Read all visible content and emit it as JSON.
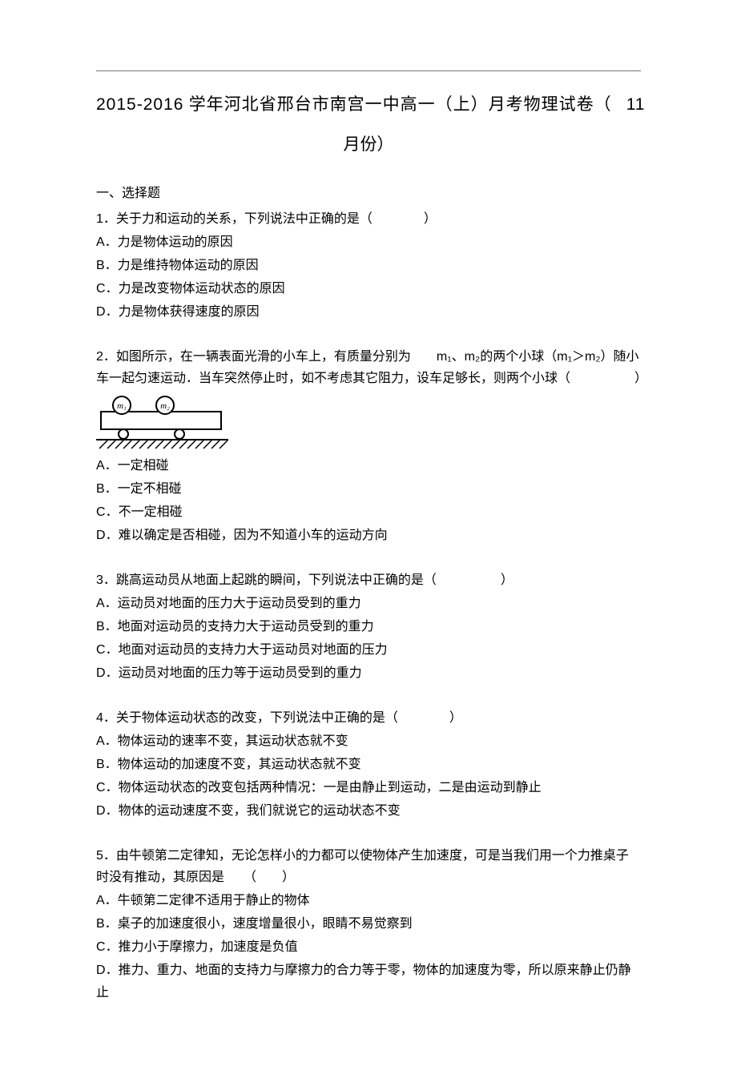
{
  "title": {
    "prefix_years": "2015-2016",
    "main_cn": " 学年河北省邢台市南宫一中高一（上）月考物理试卷（",
    "month_num": "11",
    "line2": "月份）"
  },
  "section_heading": "一、选择题",
  "q1": {
    "stem_num": "1",
    "stem_text": "．关于力和运动的关系，下列说法中正确的是（　　　　）",
    "optA_label": "A",
    "optA_text": "．力是物体运动的原因",
    "optB_label": "B",
    "optB_text": "．力是维持物体运动的原因",
    "optC_label": "C",
    "optC_text": "．力是改变物体运动状态的原因",
    "optD_label": "D",
    "optD_text": "．力是物体获得速度的原因"
  },
  "q2": {
    "stem_num": "2",
    "stem_part1": "．如图所示，在一辆表面光滑的小车上，有质量分别为　　",
    "m1": "m₁",
    "sep1": "、",
    "m2": "m₂",
    "stem_part2": "的两个小球（",
    "m1b": "m₁",
    "gt": "＞",
    "m2b": "m₂",
    "stem_part3": "）随小车一起匀速运动．当车突然停止时，如不考虑其它阻力，设车足够长，则两个小球（　　　　　）",
    "fig_m1": "m₁",
    "fig_m2": "m₂",
    "optA_label": "A",
    "optA_text": "．一定相碰",
    "optB_label": "B",
    "optB_text": "．一定不相碰",
    "optC_label": "C",
    "optC_text": "．不一定相碰",
    "optD_label": "D",
    "optD_text": "．难以确定是否相碰，因为不知道小车的运动方向"
  },
  "q3": {
    "stem_num": "3",
    "stem_text": "．跳高运动员从地面上起跳的瞬间，下列说法中正确的是（　　　　　）",
    "optA_label": "A",
    "optA_text": "．运动员对地面的压力大于运动员受到的重力",
    "optB_label": "B",
    "optB_text": "．地面对运动员的支持力大于运动员受到的重力",
    "optC_label": "C",
    "optC_text": "．地面对运动员的支持力大于运动员对地面的压力",
    "optD_label": "D",
    "optD_text": "．运动员对地面的压力等于运动员受到的重力"
  },
  "q4": {
    "stem_num": "4",
    "stem_text": "．关于物体运动状态的改变，下列说法中正确的是（　　　　）",
    "optA_label": "A",
    "optA_text": "．物体运动的速率不变，其运动状态就不变",
    "optB_label": "B",
    "optB_text": "．物体运动的加速度不变，其运动状态就不变",
    "optC_label": "C",
    "optC_text": "．物体运动状态的改变包括两种情况：一是由静止到运动，二是由运动到静止",
    "optD_label": "D",
    "optD_text": "．物体的运动速度不变，我们就说它的运动状态不变"
  },
  "q5": {
    "stem_num": "5",
    "stem_text": "．由牛顿第二定律知，无论怎样小的力都可以使物体产生加速度，可是当我们用一个力推桌子时没有推动，其原因是　　（　　）",
    "optA_label": "A",
    "optA_text": "．牛顿第二定律不适用于静止的物体",
    "optB_label": "B",
    "optB_text": "．桌子的加速度很小，速度增量很小，眼睛不易觉察到",
    "optC_label": "C",
    "optC_text": "．推力小于摩擦力，加速度是负值",
    "optD_label": "D",
    "optD_text": "．推力、重力、地面的支持力与摩擦力的合力等于零，物体的加速度为零，所以原来静止仍静止"
  }
}
